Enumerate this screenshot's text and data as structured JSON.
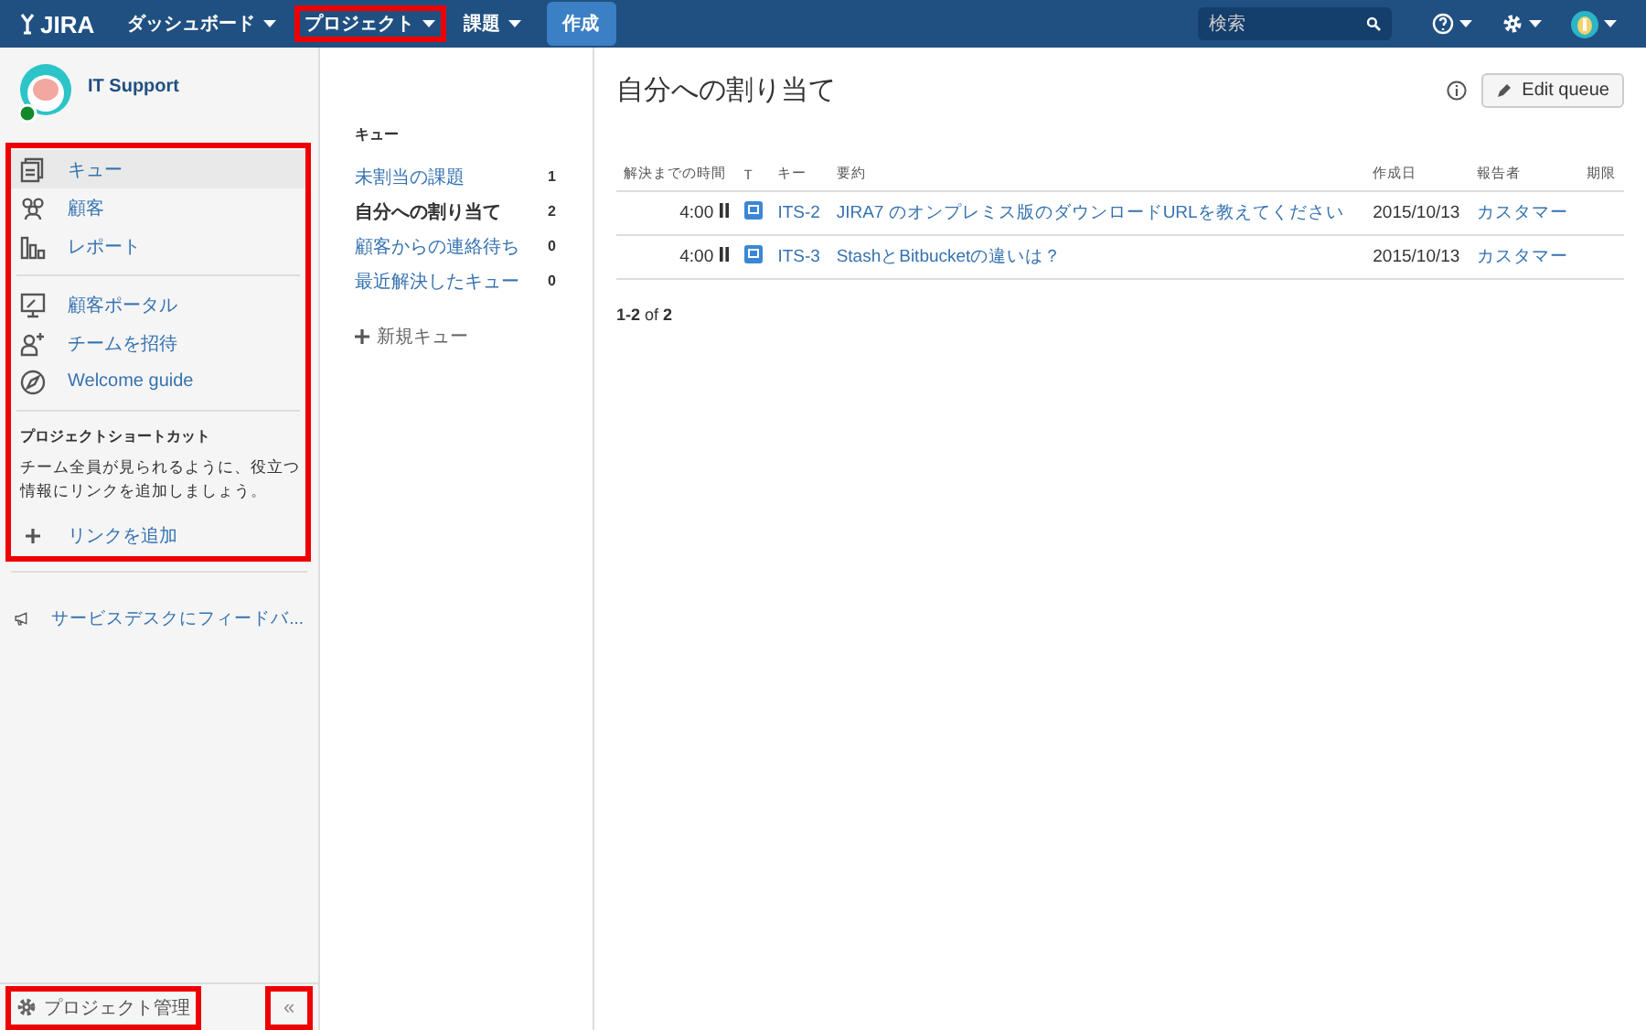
{
  "header": {
    "logo": "JIRA",
    "nav": [
      {
        "label": "ダッシュボード",
        "annotated": false
      },
      {
        "label": "プロジェクト",
        "annotated": true
      },
      {
        "label": "課題",
        "annotated": false
      }
    ],
    "create_button": "作成",
    "search": {
      "placeholder": "検索"
    }
  },
  "sidebar": {
    "project_name": "IT Support",
    "menu_annotated": true,
    "groups": [
      [
        {
          "label": "キュー",
          "selected": true
        },
        {
          "label": "顧客",
          "selected": false
        },
        {
          "label": "レポート",
          "selected": false
        }
      ],
      [
        {
          "label": "顧客ポータル",
          "selected": false
        },
        {
          "label": "チームを招待",
          "selected": false
        },
        {
          "label": "Welcome guide",
          "selected": false
        }
      ]
    ],
    "shortcuts": {
      "heading": "プロジェクトショートカット",
      "text": "チーム全員が見られるように、役立つ情報にリンクを追加しましょう。",
      "add_link": "リンクを追加"
    },
    "feedback": "サービスデスクにフィードバ...",
    "footer": {
      "admin_button": {
        "label": "プロジェクト管理",
        "annotated": true
      },
      "collapse_button": {
        "label": "«",
        "annotated": true
      }
    }
  },
  "queues": {
    "heading": "キュー",
    "items": [
      {
        "label": "未割当の課題",
        "count": "1",
        "selected": false
      },
      {
        "label": "自分への割り当て",
        "count": "2",
        "selected": true
      },
      {
        "label": "顧客からの連絡待ち",
        "count": "0",
        "selected": false
      },
      {
        "label": "最近解決したキュー",
        "count": "0",
        "selected": false
      }
    ],
    "new_queue": "新規キュー"
  },
  "main": {
    "title": "自分への割り当て",
    "edit_button": "Edit queue",
    "table": {
      "columns": [
        "解決までの時間",
        "T",
        "キー",
        "要約",
        "作成日",
        "報告者",
        "期限"
      ],
      "rows": [
        {
          "time": "4:00",
          "key": "ITS-2",
          "summary": "JIRA7 のオンプレミス版のダウンロードURLを教えてください",
          "created": "2015/10/13",
          "reporter": "カスタマー"
        },
        {
          "time": "4:00",
          "key": "ITS-3",
          "summary": "StashとBitbucketの違いは？",
          "created": "2015/10/13",
          "reporter": "カスタマー"
        }
      ]
    },
    "pagination": "**1-2** of **2**"
  }
}
